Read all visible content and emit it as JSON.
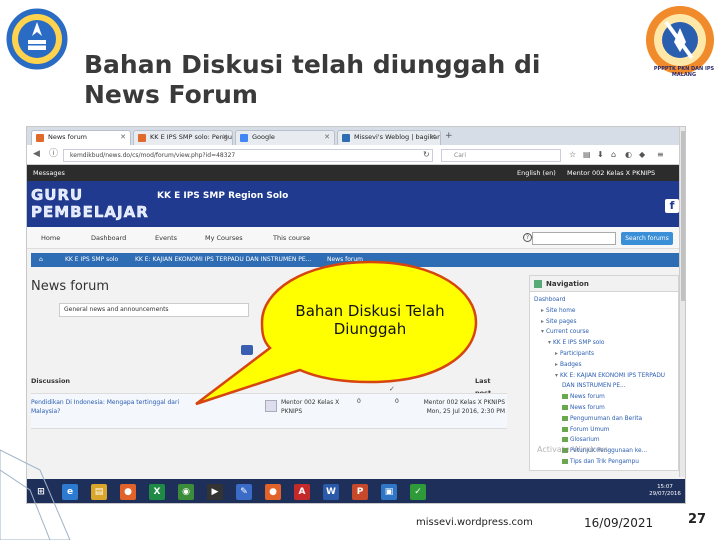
{
  "slide": {
    "title": "Bahan Diskusi telah diunggah di News Forum",
    "callout": "Bahan Diskusi Telah Diunggah",
    "footer_url": "missevi.wordpress.com",
    "footer_date": "16/09/2021",
    "slide_number": "27",
    "right_logo_text": "PPPPTK PKN DAN IPS MALANG"
  },
  "browser": {
    "tabs": [
      {
        "label": "News forum",
        "favicon": "#e06a2a",
        "active": true
      },
      {
        "label": "KK E IPS SMP solo: Pengu...",
        "favicon": "#e06a2a",
        "active": false
      },
      {
        "label": "Google",
        "favicon": "#4285f4",
        "active": false
      },
      {
        "label": "Missevi's Weblog | bagikan...",
        "favicon": "#2e6db3",
        "active": false
      }
    ],
    "new_tab": "+",
    "url": "kemdikbud/news.do/cs/mod/forum/view.php?id=48327",
    "search_placeholder": "Cari"
  },
  "moodle": {
    "messages": "Messages",
    "language": "English (en)",
    "user": "Mentor 002 Kelas X PKNIPS",
    "brand_line1": "GURU",
    "brand_line2": "PEMBELAJAR",
    "site_name": "KK E IPS SMP Region Solo",
    "facebook": "f",
    "nav": [
      "Home",
      "Dashboard",
      "Events",
      "My Courses",
      "This course"
    ],
    "search_button": "Search forums",
    "breadcrumbs": [
      "KK E IPS SMP solo",
      "KK E: KAJIAN EKONOMI IPS TERPADU DAN INSTRUMEN PE...",
      "News forum"
    ],
    "page_heading": "News forum",
    "forum_select": "General news and announcements",
    "table": {
      "col_discussion": "Discussion",
      "col_last_post": "Last post",
      "row": {
        "topic": "Pendidikan Di Indonesia: Mengapa tertinggal dari Malaysia?",
        "author": "Mentor 002 Kelas X PKNIPS",
        "replies": "0",
        "unread": "0",
        "last_post": "Mentor 002 Kelas X PKNIPS Mon, 25 Jul 2016, 2:30 PM"
      }
    },
    "navigation": {
      "title": "Navigation",
      "items": [
        {
          "label": "Dashboard",
          "level": 0,
          "kind": "text"
        },
        {
          "label": "Site home",
          "level": 1,
          "kind": "bullet"
        },
        {
          "label": "Site pages",
          "level": 1,
          "kind": "bullet"
        },
        {
          "label": "Current course",
          "level": 1,
          "kind": "open"
        },
        {
          "label": "KK E IPS SMP solo",
          "level": 2,
          "kind": "open"
        },
        {
          "label": "Participants",
          "level": 3,
          "kind": "bullet"
        },
        {
          "label": "Badges",
          "level": 3,
          "kind": "bullet"
        },
        {
          "label": "KK E: KAJIAN EKONOMI IPS TERPADU",
          "level": 3,
          "kind": "open"
        },
        {
          "label": "DAN INSTRUMEN PE...",
          "level": 4,
          "kind": "text"
        },
        {
          "label": "News forum",
          "level": 4,
          "kind": "forum"
        },
        {
          "label": "News forum",
          "level": 4,
          "kind": "forum"
        },
        {
          "label": "Pengumuman dan Berita",
          "level": 4,
          "kind": "forum"
        },
        {
          "label": "Forum Umum",
          "level": 4,
          "kind": "forum"
        },
        {
          "label": "Glosarium",
          "level": 4,
          "kind": "forum"
        },
        {
          "label": "Petunjuk Penggunaan ke...",
          "level": 4,
          "kind": "forum"
        },
        {
          "label": "Tips dan Trik Pengampu",
          "level": 4,
          "kind": "forum"
        }
      ]
    },
    "activate": "Activate Windows"
  },
  "taskbar": {
    "icons": [
      {
        "name": "start-icon",
        "color": "#1e2f5a",
        "glyph": "⊞"
      },
      {
        "name": "ie-icon",
        "color": "#2d7bd1",
        "glyph": "e"
      },
      {
        "name": "explorer-icon",
        "color": "#d9a52a",
        "glyph": "▤"
      },
      {
        "name": "firefox-icon",
        "color": "#e2632a",
        "glyph": "●"
      },
      {
        "name": "excel-icon",
        "color": "#1f8a45",
        "glyph": "X"
      },
      {
        "name": "chrome-icon",
        "color": "#3c8d3a",
        "glyph": "◉"
      },
      {
        "name": "media-icon",
        "color": "#333333",
        "glyph": "▶"
      },
      {
        "name": "paint-icon",
        "color": "#3a6bc7",
        "glyph": "✎"
      },
      {
        "name": "firefox2-icon",
        "color": "#e2632a",
        "glyph": "●"
      },
      {
        "name": "acrobat-icon",
        "color": "#c52a2a",
        "glyph": "A"
      },
      {
        "name": "word-icon",
        "color": "#2b5aab",
        "glyph": "W"
      },
      {
        "name": "powerpoint-icon",
        "color": "#c8482a",
        "glyph": "P"
      },
      {
        "name": "folder-icon",
        "color": "#2f77c6",
        "glyph": "▣"
      },
      {
        "name": "green-icon",
        "color": "#2f9a3a",
        "glyph": "✓"
      }
    ],
    "clock": "15:07",
    "date": "29/07/2016"
  }
}
